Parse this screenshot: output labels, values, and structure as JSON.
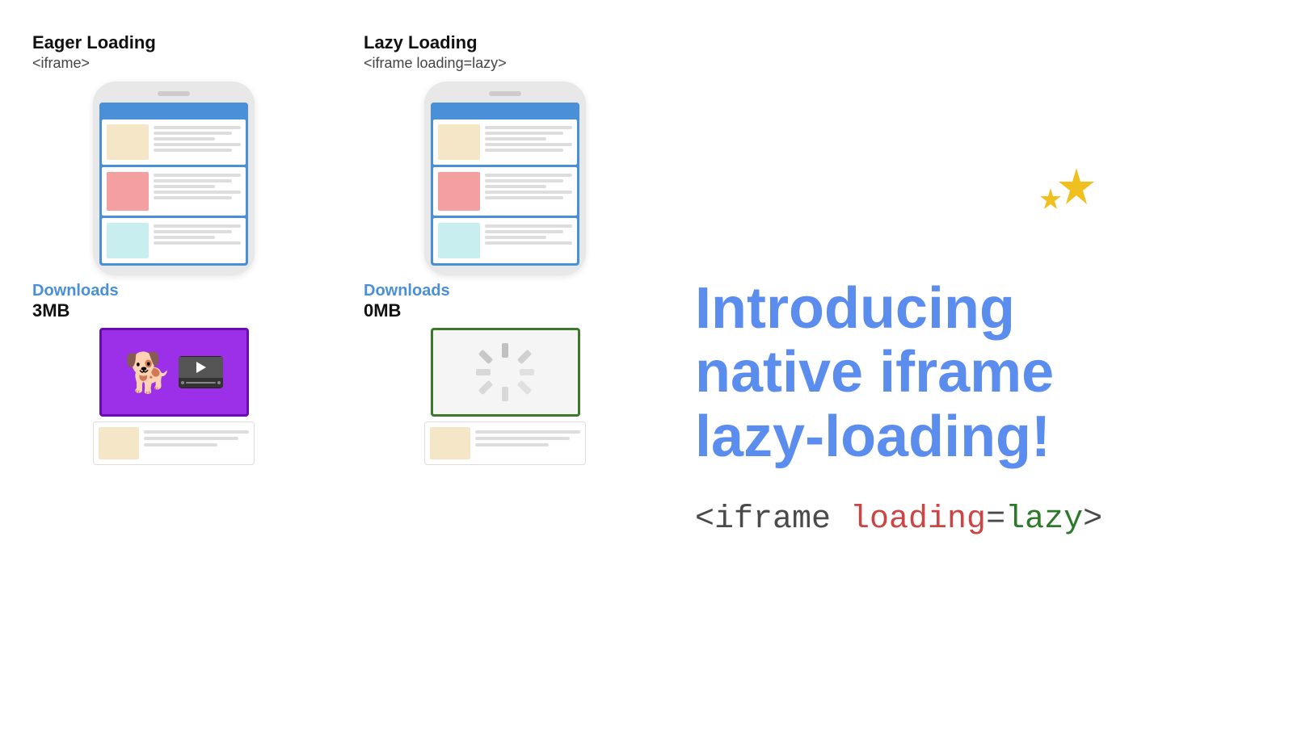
{
  "page": {
    "background": "#ffffff"
  },
  "left_column": {
    "title": "Eager Loading",
    "subtitle": "<iframe>",
    "downloads_label": "Downloads",
    "downloads_size": "3MB"
  },
  "right_column": {
    "title": "Lazy Loading",
    "subtitle": "<iframe loading=lazy>",
    "downloads_label": "Downloads",
    "downloads_size": "0MB"
  },
  "headline": {
    "line1": "Introducing",
    "line2": "native iframe",
    "line3": "lazy-loading!"
  },
  "code": {
    "prefix": "<iframe ",
    "attr_loading": "loading",
    "equals": "=",
    "value_lazy": "lazy",
    "suffix": ">"
  },
  "cards": {
    "card1_color": "#f5e6c8",
    "card2_color": "#f5a0a0",
    "card3_color": "#c8eef0"
  }
}
